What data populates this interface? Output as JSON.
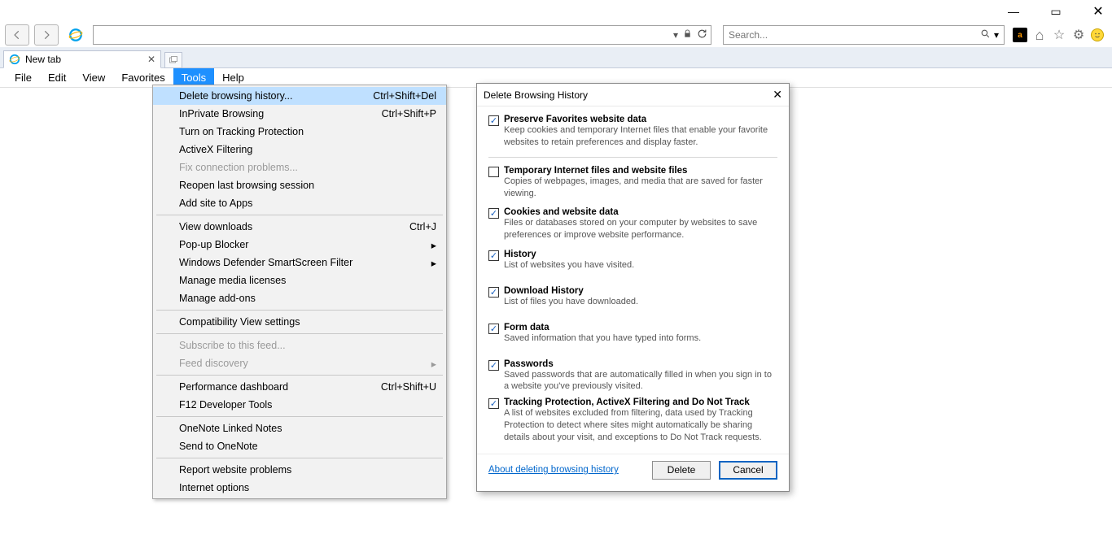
{
  "window_controls": {
    "minimize": "—",
    "maximize": "▭",
    "close": "✕"
  },
  "nav": {
    "address_value": "",
    "search_placeholder": "Search..."
  },
  "toolbar_icons": {
    "amazon": "a",
    "home": "⌂",
    "star": "☆",
    "gear": "⚙",
    "smiley": ":)"
  },
  "tab": {
    "title": "New tab"
  },
  "menu": {
    "items": [
      "File",
      "Edit",
      "View",
      "Favorites",
      "Tools",
      "Help"
    ],
    "active_index": 4
  },
  "tools_menu": {
    "items": [
      {
        "label": "Delete browsing history...",
        "shortcut": "Ctrl+Shift+Del",
        "highlight": true
      },
      {
        "label": "InPrivate Browsing",
        "shortcut": "Ctrl+Shift+P"
      },
      {
        "label": "Turn on Tracking Protection"
      },
      {
        "label": "ActiveX Filtering"
      },
      {
        "label": "Fix connection problems...",
        "disabled": true
      },
      {
        "label": "Reopen last browsing session"
      },
      {
        "label": "Add site to Apps"
      },
      {
        "type": "sep"
      },
      {
        "label": "View downloads",
        "shortcut": "Ctrl+J"
      },
      {
        "label": "Pop-up Blocker",
        "submenu": true
      },
      {
        "label": "Windows Defender SmartScreen Filter",
        "submenu": true
      },
      {
        "label": "Manage media licenses"
      },
      {
        "label": "Manage add-ons"
      },
      {
        "type": "sep"
      },
      {
        "label": "Compatibility View settings"
      },
      {
        "type": "sep"
      },
      {
        "label": "Subscribe to this feed...",
        "disabled": true
      },
      {
        "label": "Feed discovery",
        "disabled": true,
        "submenu": true
      },
      {
        "type": "sep"
      },
      {
        "label": "Performance dashboard",
        "shortcut": "Ctrl+Shift+U"
      },
      {
        "label": "F12 Developer Tools"
      },
      {
        "type": "sep"
      },
      {
        "label": "OneNote Linked Notes"
      },
      {
        "label": "Send to OneNote"
      },
      {
        "type": "sep"
      },
      {
        "label": "Report website problems"
      },
      {
        "label": "Internet options"
      }
    ]
  },
  "dialog": {
    "title": "Delete Browsing History",
    "options": [
      {
        "checked": true,
        "title": "Preserve Favorites website data",
        "desc": "Keep cookies and temporary Internet files that enable your favorite websites to retain preferences and display faster.",
        "hr_after": true
      },
      {
        "checked": false,
        "title": "Temporary Internet files and website files",
        "desc": "Copies of webpages, images, and media that are saved for faster viewing."
      },
      {
        "checked": true,
        "title": "Cookies and website data",
        "desc": "Files or databases stored on your computer by websites to save preferences or improve website performance."
      },
      {
        "checked": true,
        "title": "History",
        "desc": "List of websites you have visited.",
        "gap_after": true
      },
      {
        "checked": true,
        "title": "Download History",
        "desc": "List of files you have downloaded.",
        "gap_after": true
      },
      {
        "checked": true,
        "title": "Form data",
        "desc": "Saved information that you have typed into forms.",
        "gap_after": true
      },
      {
        "checked": true,
        "title": "Passwords",
        "desc": "Saved passwords that are automatically filled in when you sign in to a website you've previously visited."
      },
      {
        "checked": true,
        "title": "Tracking Protection, ActiveX Filtering and Do Not Track",
        "desc": "A list of websites excluded from filtering, data used by Tracking Protection to detect where sites might automatically be sharing details about your visit, and exceptions to Do Not Track requests."
      }
    ],
    "about_link": "About deleting browsing history",
    "delete_btn": "Delete",
    "cancel_btn": "Cancel"
  }
}
